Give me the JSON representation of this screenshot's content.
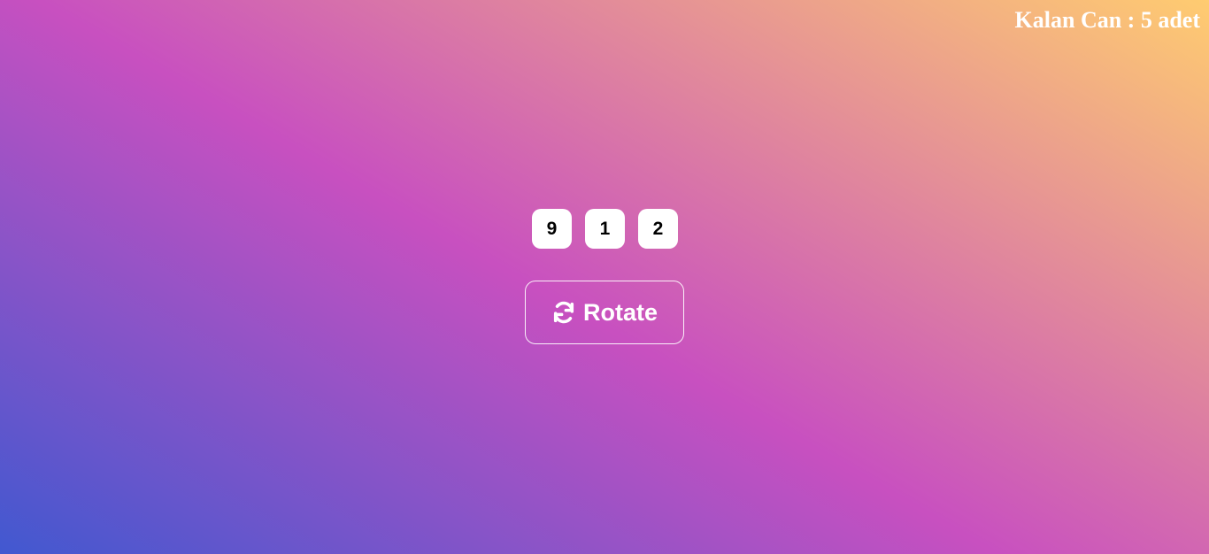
{
  "status": {
    "lives_text": "Kalan Can : 5 adet"
  },
  "digits": [
    "9",
    "1",
    "2"
  ],
  "rotate_button": {
    "label": "Rotate",
    "icon": "sync-icon"
  },
  "colors": {
    "gradient_start": "#4158d0",
    "gradient_mid": "#c850c0",
    "gradient_end": "#ffcc70",
    "tile_background": "#ffffff",
    "text_light": "#ffffff"
  }
}
